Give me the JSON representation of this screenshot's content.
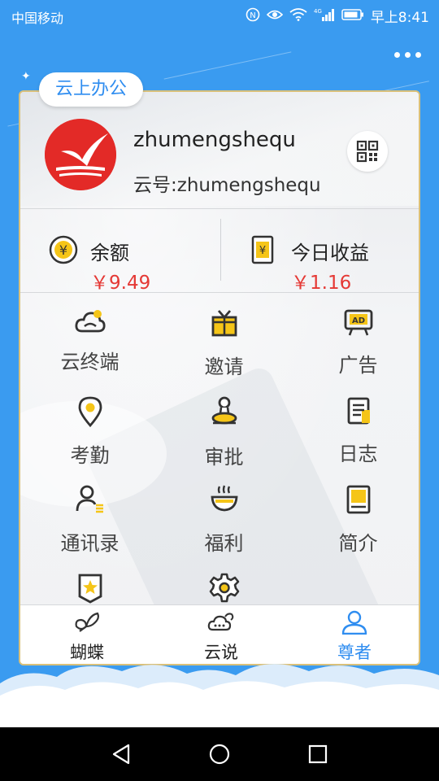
{
  "statusbar": {
    "carrier": "中国移动",
    "network": "4G",
    "time": "早上8:41"
  },
  "header": {
    "section_tag": "云上办公"
  },
  "profile": {
    "username": "zhumengshequ",
    "cloud_id": "云号:zhumengshequ"
  },
  "stats": {
    "balance_label": "余额",
    "balance_value": "￥9.49",
    "today_label": "今日收益",
    "today_value": "￥1.16"
  },
  "grid": {
    "items": [
      {
        "label": "云终端",
        "icon": "cloud-terminal-icon"
      },
      {
        "label": "邀请",
        "icon": "gift-icon"
      },
      {
        "label": "广告",
        "icon": "ad-icon"
      },
      {
        "label": "考勤",
        "icon": "location-pin-icon"
      },
      {
        "label": "审批",
        "icon": "stamp-icon"
      },
      {
        "label": "日志",
        "icon": "log-icon"
      },
      {
        "label": "通讯录",
        "icon": "contacts-icon"
      },
      {
        "label": "福利",
        "icon": "bowl-icon"
      },
      {
        "label": "简介",
        "icon": "book-icon"
      },
      {
        "label": "",
        "icon": "star-badge-icon"
      },
      {
        "label": "",
        "icon": "settings-gear-icon"
      }
    ]
  },
  "tabs": [
    {
      "label": "蝴蝶",
      "icon": "butterfly-icon",
      "active": false
    },
    {
      "label": "云说",
      "icon": "chat-cloud-icon",
      "active": false
    },
    {
      "label": "尊者",
      "icon": "person-icon",
      "active": true
    }
  ],
  "colors": {
    "brand_blue": "#3a9bf0",
    "accent_blue": "#2f8df0",
    "money_red": "#e53935",
    "icon_yellow": "#f5c518",
    "avatar_red": "#e32a27"
  }
}
